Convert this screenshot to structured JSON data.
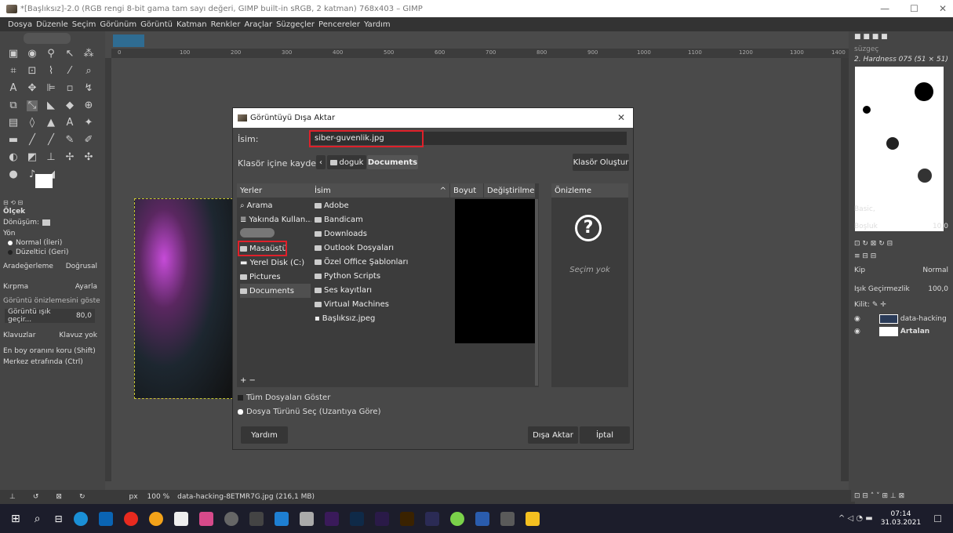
{
  "window": {
    "title": "*[Başlıksız]-2.0 (RGB rengi 8-bit gama tam sayı değeri, GIMP built-in sRGB, 2 katman) 768x403 – GIMP"
  },
  "menu": [
    "Dosya",
    "Düzenle",
    "Seçim",
    "Görünüm",
    "Görüntü",
    "Katman",
    "Renkler",
    "Araçlar",
    "Süzgeçler",
    "Pencereler",
    "Yardım"
  ],
  "tool_options": {
    "tool_name": "Ölçek",
    "transform_label": "Dönüşüm:",
    "direction_label": "Yön",
    "direction_normal": "Normal (İleri)",
    "direction_corrective": "Düzeltici (Geri)",
    "interpolation_label": "Aradeğerleme",
    "interpolation_value": "Doğrusal",
    "clipping_label": "Kırpma",
    "clipping_value": "Ayarla",
    "preview_label": "Görüntü önizlemesini göste",
    "opacity_label": "Görüntü ışık geçir...",
    "opacity_value": "80,0",
    "guides_label": "Klavuzlar",
    "guides_value": "Klavuz yok",
    "keep_aspect": "En boy oranını koru (Shift)",
    "around_center": "Merkez etrafında (Ctrl)"
  },
  "ruler_ticks": [
    "0",
    "100",
    "200",
    "300",
    "400",
    "500",
    "600",
    "700",
    "800",
    "900",
    "1000",
    "1100",
    "1200",
    "1300",
    "1400"
  ],
  "status": {
    "unit": "px",
    "zoom": "100 %",
    "filename": "data-hacking-8ETMR7G.jpg (216,1 MB)"
  },
  "brushes": {
    "filter_placeholder": "süzgeç",
    "current": "2. Hardness 075 (51 × 51)",
    "category": "Basic,",
    "spacing_label": "Boşluk",
    "spacing_value": "10,0"
  },
  "layers": {
    "mode_label": "Kip",
    "mode_value": "Normal",
    "opacity_label": "Işık Geçirmezlik",
    "opacity_value": "100,0",
    "lock_label": "Kilit:",
    "items": [
      {
        "name": "data-hacking"
      },
      {
        "name": "Artalan"
      }
    ]
  },
  "dialog": {
    "title": "Görüntüyü Dışa Aktar",
    "name_label": "İsim:",
    "name_value": "siber-guvenlik.jpg",
    "save_in_label": "Klasör içine kaydet:",
    "path": [
      "doguk",
      "Documents"
    ],
    "create_folder": "Klasör Oluştur",
    "places_header": "Yerler",
    "places": [
      "Arama",
      "Yakında Kullan...",
      "",
      "Masaüstü",
      "Yerel Disk (C:)",
      "Pictures",
      "Documents"
    ],
    "col_name": "İsim",
    "col_size": "Boyut",
    "col_modified": "Değiştirilme",
    "files": [
      "Adobe",
      "Bandicam",
      "Downloads",
      "Outlook Dosyaları",
      "Özel Office Şablonları",
      "Python Scripts",
      "Ses kayıtları",
      "Virtual Machines",
      "Başlıksız.jpeg"
    ],
    "preview_header": "Önizleme",
    "preview_none": "Seçim yok",
    "add_remove": "+ −",
    "show_all_files": "Tüm Dosyaları Göster",
    "select_file_type": "Dosya Türünü Seç (Uzantıya Göre)",
    "help": "Yardım",
    "export": "Dışa Aktar",
    "cancel": "İptal"
  },
  "taskbar": {
    "time": "07:14",
    "date": "31.03.2021"
  },
  "colors": {
    "highlight_red": "#e0202a",
    "dark_panel": "#3c3c3c",
    "taskbar": "#1c1d2b"
  }
}
